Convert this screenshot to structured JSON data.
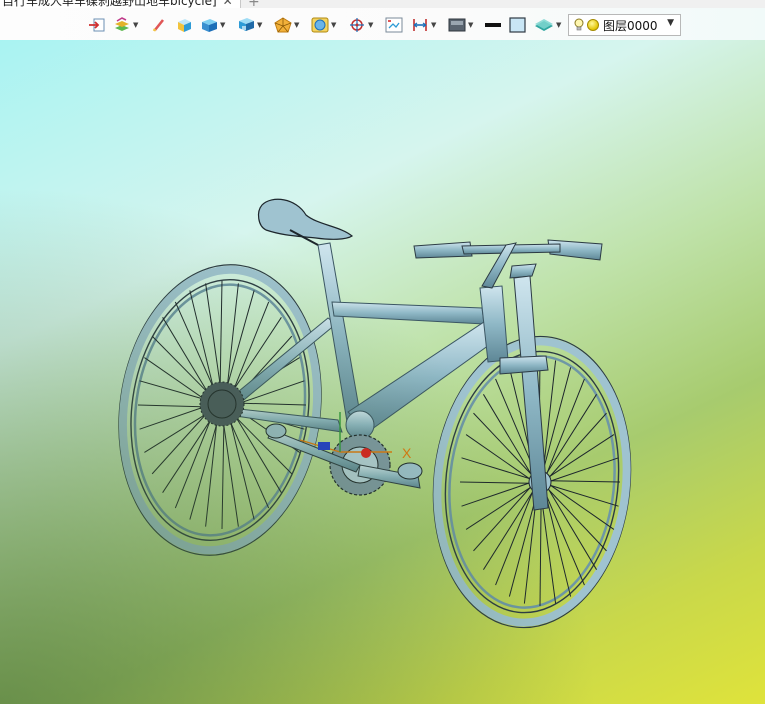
{
  "tab": {
    "title": "自行车成人单车碟刹越野山地车bicycle]",
    "close_icon": "close-icon",
    "add_icon": "plus-icon"
  },
  "toolbar": {
    "tools": [
      {
        "name": "import-icon"
      },
      {
        "name": "layers-stack-icon"
      },
      {
        "name": "sketch-pen-icon"
      },
      {
        "name": "solid-box-icon"
      },
      {
        "name": "box-view-icon"
      },
      {
        "name": "shaded-box-icon"
      },
      {
        "name": "polygon-shape-icon"
      },
      {
        "name": "render-style-icon"
      },
      {
        "name": "snap-target-icon"
      },
      {
        "name": "screen-capture-icon"
      },
      {
        "name": "dimension-icon"
      },
      {
        "name": "display-mode-icon"
      },
      {
        "name": "line-color-swatch-icon"
      },
      {
        "name": "fill-color-swatch-icon"
      },
      {
        "name": "material-plane-icon"
      }
    ],
    "layer": {
      "name": "图层0000",
      "bulb_icon": "lightbulb-icon",
      "color_icon": "layer-color-icon"
    }
  },
  "viewport": {
    "gradient_colors": [
      "#a9f3f2",
      "#bfe2a9",
      "#dfe33b"
    ],
    "model": "bicycle",
    "model_color": "#8fb8c6",
    "axis_label": "X"
  }
}
